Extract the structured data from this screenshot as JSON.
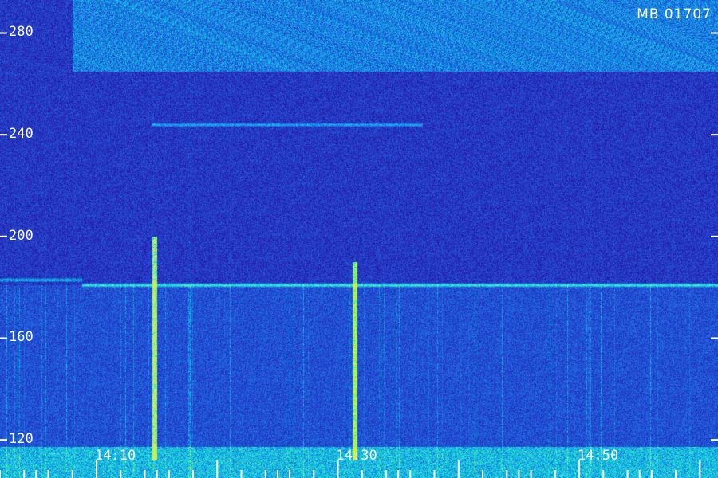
{
  "badge": "MB 01707",
  "chart_data": {
    "type": "heatmap",
    "title": "",
    "xlabel": "",
    "ylabel": "",
    "x_tick_labels": [
      "14:10",
      "14:30",
      "14:50"
    ],
    "x_tick_values_min": [
      850,
      870,
      890
    ],
    "xlim_min": [
      842.0,
      901.5
    ],
    "y_tick_values": [
      120,
      160,
      200,
      240,
      280
    ],
    "ylim": [
      105,
      293
    ],
    "colormap": [
      "#0c0640",
      "#2a1aa8",
      "#1f5ce0",
      "#10b4e8",
      "#30f0c8",
      "#c8f050"
    ],
    "grid": false,
    "features": [
      {
        "kind": "horizontal-band",
        "y_from": 265,
        "y_to": 293,
        "x_from_min": 848,
        "x_to_min": 901.5,
        "intensity": 0.55
      },
      {
        "kind": "horizontal-line",
        "y": 181,
        "x_from_min": 848.8,
        "x_to_min": 901.5,
        "intensity": 0.65
      },
      {
        "kind": "horizontal-line",
        "y": 183,
        "x_from_min": 842.0,
        "x_to_min": 848.8,
        "intensity": 0.45
      },
      {
        "kind": "horizontal-line",
        "y": 244,
        "x_from_min": 854.5,
        "x_to_min": 877.0,
        "intensity": 0.4
      },
      {
        "kind": "vertical-burst",
        "x_min": 854.8,
        "y_from": 112,
        "y_to": 200,
        "intensity": 0.95
      },
      {
        "kind": "vertical-burst",
        "x_min": 871.4,
        "y_from": 112,
        "y_to": 190,
        "intensity": 0.95
      }
    ]
  }
}
